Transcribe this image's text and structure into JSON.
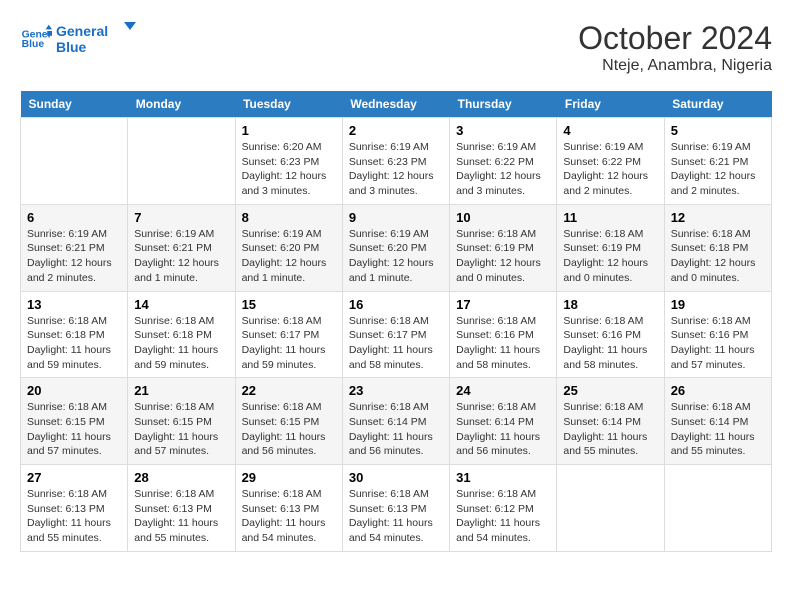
{
  "logo": {
    "line1": "General",
    "line2": "Blue"
  },
  "title": "October 2024",
  "subtitle": "Nteje, Anambra, Nigeria",
  "weekdays": [
    "Sunday",
    "Monday",
    "Tuesday",
    "Wednesday",
    "Thursday",
    "Friday",
    "Saturday"
  ],
  "weeks": [
    [
      {
        "day": "",
        "info": ""
      },
      {
        "day": "",
        "info": ""
      },
      {
        "day": "1",
        "info": "Sunrise: 6:20 AM\nSunset: 6:23 PM\nDaylight: 12 hours and 3 minutes."
      },
      {
        "day": "2",
        "info": "Sunrise: 6:19 AM\nSunset: 6:23 PM\nDaylight: 12 hours and 3 minutes."
      },
      {
        "day": "3",
        "info": "Sunrise: 6:19 AM\nSunset: 6:22 PM\nDaylight: 12 hours and 3 minutes."
      },
      {
        "day": "4",
        "info": "Sunrise: 6:19 AM\nSunset: 6:22 PM\nDaylight: 12 hours and 2 minutes."
      },
      {
        "day": "5",
        "info": "Sunrise: 6:19 AM\nSunset: 6:21 PM\nDaylight: 12 hours and 2 minutes."
      }
    ],
    [
      {
        "day": "6",
        "info": "Sunrise: 6:19 AM\nSunset: 6:21 PM\nDaylight: 12 hours and 2 minutes."
      },
      {
        "day": "7",
        "info": "Sunrise: 6:19 AM\nSunset: 6:21 PM\nDaylight: 12 hours and 1 minute."
      },
      {
        "day": "8",
        "info": "Sunrise: 6:19 AM\nSunset: 6:20 PM\nDaylight: 12 hours and 1 minute."
      },
      {
        "day": "9",
        "info": "Sunrise: 6:19 AM\nSunset: 6:20 PM\nDaylight: 12 hours and 1 minute."
      },
      {
        "day": "10",
        "info": "Sunrise: 6:18 AM\nSunset: 6:19 PM\nDaylight: 12 hours and 0 minutes."
      },
      {
        "day": "11",
        "info": "Sunrise: 6:18 AM\nSunset: 6:19 PM\nDaylight: 12 hours and 0 minutes."
      },
      {
        "day": "12",
        "info": "Sunrise: 6:18 AM\nSunset: 6:18 PM\nDaylight: 12 hours and 0 minutes."
      }
    ],
    [
      {
        "day": "13",
        "info": "Sunrise: 6:18 AM\nSunset: 6:18 PM\nDaylight: 11 hours and 59 minutes."
      },
      {
        "day": "14",
        "info": "Sunrise: 6:18 AM\nSunset: 6:18 PM\nDaylight: 11 hours and 59 minutes."
      },
      {
        "day": "15",
        "info": "Sunrise: 6:18 AM\nSunset: 6:17 PM\nDaylight: 11 hours and 59 minutes."
      },
      {
        "day": "16",
        "info": "Sunrise: 6:18 AM\nSunset: 6:17 PM\nDaylight: 11 hours and 58 minutes."
      },
      {
        "day": "17",
        "info": "Sunrise: 6:18 AM\nSunset: 6:16 PM\nDaylight: 11 hours and 58 minutes."
      },
      {
        "day": "18",
        "info": "Sunrise: 6:18 AM\nSunset: 6:16 PM\nDaylight: 11 hours and 58 minutes."
      },
      {
        "day": "19",
        "info": "Sunrise: 6:18 AM\nSunset: 6:16 PM\nDaylight: 11 hours and 57 minutes."
      }
    ],
    [
      {
        "day": "20",
        "info": "Sunrise: 6:18 AM\nSunset: 6:15 PM\nDaylight: 11 hours and 57 minutes."
      },
      {
        "day": "21",
        "info": "Sunrise: 6:18 AM\nSunset: 6:15 PM\nDaylight: 11 hours and 57 minutes."
      },
      {
        "day": "22",
        "info": "Sunrise: 6:18 AM\nSunset: 6:15 PM\nDaylight: 11 hours and 56 minutes."
      },
      {
        "day": "23",
        "info": "Sunrise: 6:18 AM\nSunset: 6:14 PM\nDaylight: 11 hours and 56 minutes."
      },
      {
        "day": "24",
        "info": "Sunrise: 6:18 AM\nSunset: 6:14 PM\nDaylight: 11 hours and 56 minutes."
      },
      {
        "day": "25",
        "info": "Sunrise: 6:18 AM\nSunset: 6:14 PM\nDaylight: 11 hours and 55 minutes."
      },
      {
        "day": "26",
        "info": "Sunrise: 6:18 AM\nSunset: 6:14 PM\nDaylight: 11 hours and 55 minutes."
      }
    ],
    [
      {
        "day": "27",
        "info": "Sunrise: 6:18 AM\nSunset: 6:13 PM\nDaylight: 11 hours and 55 minutes."
      },
      {
        "day": "28",
        "info": "Sunrise: 6:18 AM\nSunset: 6:13 PM\nDaylight: 11 hours and 55 minutes."
      },
      {
        "day": "29",
        "info": "Sunrise: 6:18 AM\nSunset: 6:13 PM\nDaylight: 11 hours and 54 minutes."
      },
      {
        "day": "30",
        "info": "Sunrise: 6:18 AM\nSunset: 6:13 PM\nDaylight: 11 hours and 54 minutes."
      },
      {
        "day": "31",
        "info": "Sunrise: 6:18 AM\nSunset: 6:12 PM\nDaylight: 11 hours and 54 minutes."
      },
      {
        "day": "",
        "info": ""
      },
      {
        "day": "",
        "info": ""
      }
    ]
  ]
}
